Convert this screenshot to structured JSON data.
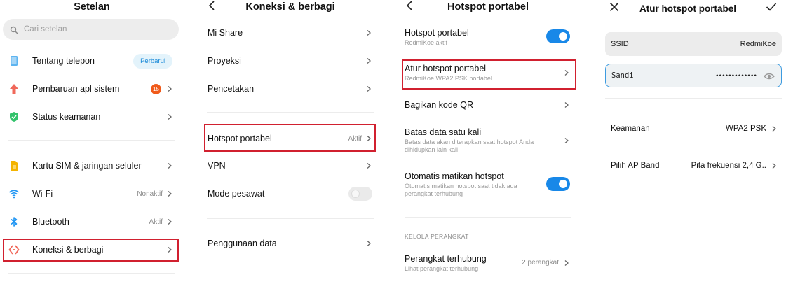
{
  "panel1": {
    "title": "Setelan",
    "search_placeholder": "Cari setelan",
    "items": [
      {
        "label": "Tentang telepon",
        "badge": "Perbarui"
      },
      {
        "label": "Pembaruan apl sistem",
        "count": "15"
      },
      {
        "label": "Status keamanan"
      },
      {
        "label": "Kartu SIM & jaringan seluler"
      },
      {
        "label": "Wi-Fi",
        "value": "Nonaktif"
      },
      {
        "label": "Bluetooth",
        "value": "Aktif"
      },
      {
        "label": "Koneksi & berbagi"
      }
    ]
  },
  "panel2": {
    "title": "Koneksi & berbagi",
    "items": [
      {
        "label": "Mi Share"
      },
      {
        "label": "Proyeksi"
      },
      {
        "label": "Pencetakan"
      },
      {
        "label": "Hotspot portabel",
        "value": "Aktif"
      },
      {
        "label": "VPN"
      },
      {
        "label": "Mode pesawat"
      },
      {
        "label": "Penggunaan data"
      }
    ]
  },
  "panel3": {
    "title": "Hotspot portabel",
    "items": [
      {
        "label": "Hotspot portabel",
        "sub": "RedmiKoe aktif"
      },
      {
        "label": "Atur hotspot portabel",
        "sub": "RedmiKoe WPA2 PSK portabel"
      },
      {
        "label": "Bagikan kode QR"
      },
      {
        "label": "Batas data satu kali",
        "sub1": "Batas data akan diterapkan saat hotspot Anda",
        "sub2": "dihidupkan lain kali"
      },
      {
        "label": "Otomatis matikan hotspot",
        "sub1": "Otomatis matikan hotspot saat tidak ada",
        "sub2": "perangkat terhubung"
      }
    ],
    "section_header": "KELOLA PERANGKAT",
    "connected": {
      "label": "Perangkat terhubung",
      "sub": "Lihat perangkat terhubung",
      "value": "2 perangkat"
    }
  },
  "panel4": {
    "title": "Atur hotspot portabel",
    "ssid_label": "SSID",
    "ssid_value": "RedmiKoe",
    "password_label": "Sandi",
    "password_value": "•••••••••••••",
    "security_label": "Keamanan",
    "security_value": "WPA2 PSK",
    "band_label": "Pilih AP Band",
    "band_value": "Pita frekuensi 2,4 G.."
  },
  "colors": {
    "accent": "#1888e8",
    "highlight": "#d1202f",
    "badge_orange": "#f05a1a"
  }
}
